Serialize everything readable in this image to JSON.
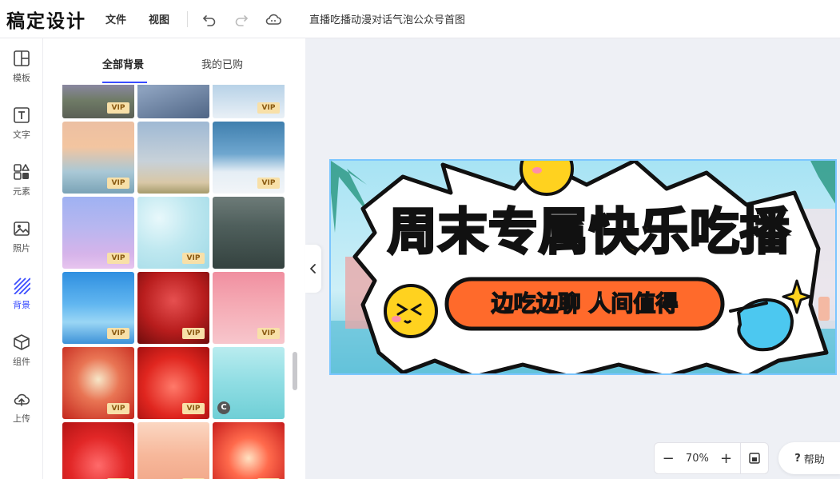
{
  "app": {
    "logo": "稿定设计"
  },
  "menu": [
    {
      "label": "文件"
    },
    {
      "label": "视图"
    }
  ],
  "toolbar": {
    "undo_icon": "undo-icon",
    "redo_icon": "redo-icon",
    "cloud_icon": "cloud-icon"
  },
  "document": {
    "title": "直播吃播动漫对话气泡公众号首图"
  },
  "rail": {
    "items": [
      {
        "label": "模板",
        "icon": "template-icon"
      },
      {
        "label": "文字",
        "icon": "text-icon"
      },
      {
        "label": "元素",
        "icon": "elements-icon"
      },
      {
        "label": "照片",
        "icon": "photo-icon"
      },
      {
        "label": "背景",
        "icon": "background-icon",
        "active": true
      },
      {
        "label": "组件",
        "icon": "component-icon"
      },
      {
        "label": "上传",
        "icon": "upload-icon"
      }
    ]
  },
  "panel": {
    "tabs": [
      {
        "label": "全部背景",
        "active": true
      },
      {
        "label": "我的已购"
      }
    ],
    "badge_label": "VIP",
    "copyright_badge": "C",
    "thumbnails": [
      {
        "vip": true
      },
      {
        "vip": false
      },
      {
        "vip": true
      },
      {
        "vip": true
      },
      {
        "vip": false
      },
      {
        "vip": true
      },
      {
        "vip": true
      },
      {
        "vip": true
      },
      {
        "vip": false
      },
      {
        "vip": true
      },
      {
        "vip": true
      },
      {
        "vip": true
      },
      {
        "vip": true
      },
      {
        "vip": true
      },
      {
        "vip": false,
        "copyright": true
      },
      {
        "vip": true
      },
      {
        "vip": true
      },
      {
        "vip": true
      }
    ]
  },
  "canvas": {
    "headline": "周末专属快乐吃播",
    "subheadline": "边吃边聊 人间值得"
  },
  "zoom": {
    "value": "70%",
    "minus": "−",
    "plus": "+"
  },
  "help": {
    "label": "帮助",
    "icon": "?"
  },
  "colors": {
    "accent": "#3a4dff",
    "vip_bg": "#f8e0a8",
    "headline_yellow": "#ffd21f",
    "pill_orange": "#ff6a2b"
  }
}
